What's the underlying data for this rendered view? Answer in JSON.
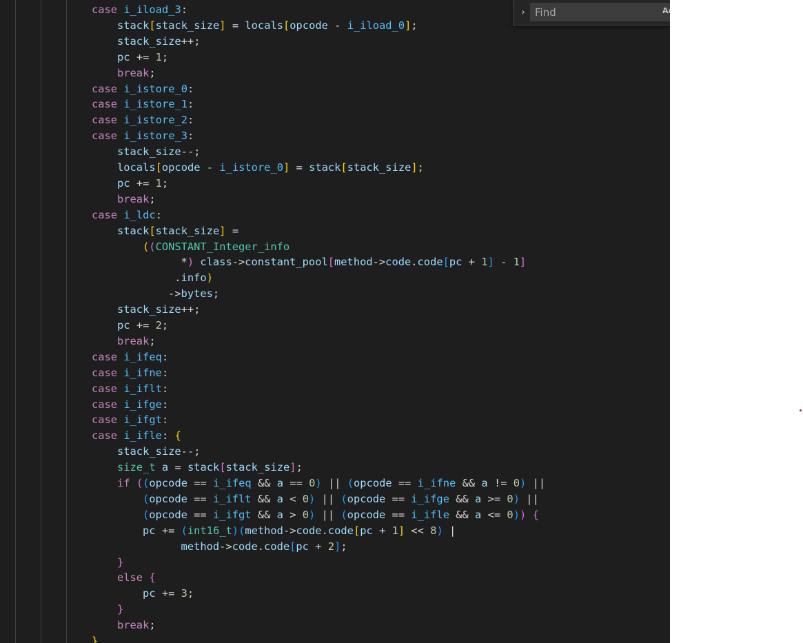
{
  "find_widget": {
    "toggle_icon": "chevron-right-icon",
    "placeholder": "Find",
    "value": "",
    "match_case_label": "Aa"
  },
  "code": {
    "lines": [
      {
        "indent": 2,
        "tokens": [
          [
            "case ",
            "k"
          ],
          [
            "i_iload_3",
            "c"
          ],
          [
            ":",
            "o"
          ]
        ]
      },
      {
        "indent": 3,
        "tokens": [
          [
            "stack",
            "i"
          ],
          [
            "[",
            "b1"
          ],
          [
            "stack_size",
            "i"
          ],
          [
            "]",
            "b1"
          ],
          [
            " = ",
            "o"
          ],
          [
            "locals",
            "i"
          ],
          [
            "[",
            "b1"
          ],
          [
            "opcode",
            "i"
          ],
          [
            " - ",
            "o"
          ],
          [
            "i_iload_0",
            "c"
          ],
          [
            "]",
            "b1"
          ],
          [
            ";",
            "o"
          ]
        ]
      },
      {
        "indent": 3,
        "tokens": [
          [
            "stack_size",
            "i"
          ],
          [
            "++;",
            "o"
          ]
        ]
      },
      {
        "indent": 3,
        "tokens": [
          [
            "pc",
            "i"
          ],
          [
            " += ",
            "o"
          ],
          [
            "1",
            "n"
          ],
          [
            ";",
            "o"
          ]
        ]
      },
      {
        "indent": 3,
        "tokens": [
          [
            "break",
            "k"
          ],
          [
            ";",
            "o"
          ]
        ]
      },
      {
        "indent": 2,
        "tokens": [
          [
            "case ",
            "k"
          ],
          [
            "i_istore_0",
            "c"
          ],
          [
            ":",
            "o"
          ]
        ]
      },
      {
        "indent": 2,
        "tokens": [
          [
            "case ",
            "k"
          ],
          [
            "i_istore_1",
            "c"
          ],
          [
            ":",
            "o"
          ]
        ]
      },
      {
        "indent": 2,
        "tokens": [
          [
            "case ",
            "k"
          ],
          [
            "i_istore_2",
            "c"
          ],
          [
            ":",
            "o"
          ]
        ]
      },
      {
        "indent": 2,
        "tokens": [
          [
            "case ",
            "k"
          ],
          [
            "i_istore_3",
            "c"
          ],
          [
            ":",
            "o"
          ]
        ]
      },
      {
        "indent": 3,
        "tokens": [
          [
            "stack_size",
            "i"
          ],
          [
            "--;",
            "o"
          ]
        ]
      },
      {
        "indent": 3,
        "tokens": [
          [
            "locals",
            "i"
          ],
          [
            "[",
            "b1"
          ],
          [
            "opcode",
            "i"
          ],
          [
            " - ",
            "o"
          ],
          [
            "i_istore_0",
            "c"
          ],
          [
            "]",
            "b1"
          ],
          [
            " = ",
            "o"
          ],
          [
            "stack",
            "i"
          ],
          [
            "[",
            "b1"
          ],
          [
            "stack_size",
            "i"
          ],
          [
            "]",
            "b1"
          ],
          [
            ";",
            "o"
          ]
        ]
      },
      {
        "indent": 3,
        "tokens": [
          [
            "pc",
            "i"
          ],
          [
            " += ",
            "o"
          ],
          [
            "1",
            "n"
          ],
          [
            ";",
            "o"
          ]
        ]
      },
      {
        "indent": 3,
        "tokens": [
          [
            "break",
            "k"
          ],
          [
            ";",
            "o"
          ]
        ]
      },
      {
        "indent": 2,
        "tokens": [
          [
            "case ",
            "k"
          ],
          [
            "i_ldc",
            "c"
          ],
          [
            ":",
            "o"
          ]
        ]
      },
      {
        "indent": 3,
        "tokens": [
          [
            "stack",
            "i"
          ],
          [
            "[",
            "b1"
          ],
          [
            "stack_size",
            "i"
          ],
          [
            "]",
            "b1"
          ],
          [
            " =",
            "o"
          ]
        ]
      },
      {
        "indent": 4,
        "tokens": [
          [
            "(",
            "b1"
          ],
          [
            "(",
            "b2"
          ],
          [
            "CONSTANT_Integer_info",
            "t"
          ]
        ]
      },
      {
        "indent": 5,
        "tokens": [
          [
            "  *",
            "o"
          ],
          [
            ")",
            "b2"
          ],
          [
            " ",
            "o"
          ],
          [
            "class",
            "i"
          ],
          [
            "->",
            "o"
          ],
          [
            "constant_pool",
            "i"
          ],
          [
            "[",
            "b2"
          ],
          [
            "method",
            "i"
          ],
          [
            "->",
            "o"
          ],
          [
            "code",
            "i"
          ],
          [
            ".",
            "o"
          ],
          [
            "code",
            "i"
          ],
          [
            "[",
            "b3"
          ],
          [
            "pc",
            "i"
          ],
          [
            " + ",
            "o"
          ],
          [
            "1",
            "n"
          ],
          [
            "]",
            "b3"
          ],
          [
            " - ",
            "o"
          ],
          [
            "1",
            "n"
          ],
          [
            "]",
            "b2"
          ]
        ]
      },
      {
        "indent": 5,
        "tokens": [
          [
            " .",
            "o"
          ],
          [
            "info",
            "i"
          ],
          [
            ")",
            "b1"
          ]
        ]
      },
      {
        "indent": 5,
        "tokens": [
          [
            "->",
            "o"
          ],
          [
            "bytes",
            "i"
          ],
          [
            ";",
            "o"
          ]
        ]
      },
      {
        "indent": 3,
        "tokens": [
          [
            "stack_size",
            "i"
          ],
          [
            "++;",
            "o"
          ]
        ]
      },
      {
        "indent": 3,
        "tokens": [
          [
            "pc",
            "i"
          ],
          [
            " += ",
            "o"
          ],
          [
            "2",
            "n"
          ],
          [
            ";",
            "o"
          ]
        ]
      },
      {
        "indent": 3,
        "tokens": [
          [
            "break",
            "k"
          ],
          [
            ";",
            "o"
          ]
        ]
      },
      {
        "indent": 2,
        "tokens": [
          [
            "case ",
            "k"
          ],
          [
            "i_ifeq",
            "c"
          ],
          [
            ":",
            "o"
          ]
        ]
      },
      {
        "indent": 2,
        "tokens": [
          [
            "case ",
            "k"
          ],
          [
            "i_ifne",
            "c"
          ],
          [
            ":",
            "o"
          ]
        ]
      },
      {
        "indent": 2,
        "tokens": [
          [
            "case ",
            "k"
          ],
          [
            "i_iflt",
            "c"
          ],
          [
            ":",
            "o"
          ]
        ]
      },
      {
        "indent": 2,
        "tokens": [
          [
            "case ",
            "k"
          ],
          [
            "i_ifge",
            "c"
          ],
          [
            ":",
            "o"
          ]
        ]
      },
      {
        "indent": 2,
        "tokens": [
          [
            "case ",
            "k"
          ],
          [
            "i_ifgt",
            "c"
          ],
          [
            ":",
            "o"
          ]
        ]
      },
      {
        "indent": 2,
        "tokens": [
          [
            "case ",
            "k"
          ],
          [
            "i_ifle",
            "c"
          ],
          [
            ": ",
            "o"
          ],
          [
            "{",
            "b1"
          ]
        ]
      },
      {
        "indent": 3,
        "tokens": [
          [
            "stack_size",
            "i"
          ],
          [
            "--;",
            "o"
          ]
        ]
      },
      {
        "indent": 3,
        "tokens": [
          [
            "size_t",
            "t"
          ],
          [
            " ",
            "o"
          ],
          [
            "a",
            "i"
          ],
          [
            " = ",
            "o"
          ],
          [
            "stack",
            "i"
          ],
          [
            "[",
            "b2"
          ],
          [
            "stack_size",
            "i"
          ],
          [
            "]",
            "b2"
          ],
          [
            ";",
            "o"
          ]
        ]
      },
      {
        "indent": 3,
        "tokens": [
          [
            "if ",
            "k"
          ],
          [
            "(",
            "b2"
          ],
          [
            "(",
            "b3"
          ],
          [
            "opcode",
            "i"
          ],
          [
            " == ",
            "o"
          ],
          [
            "i_ifeq",
            "c"
          ],
          [
            " && ",
            "o"
          ],
          [
            "a",
            "i"
          ],
          [
            " == ",
            "o"
          ],
          [
            "0",
            "n"
          ],
          [
            ")",
            "b3"
          ],
          [
            " || ",
            "o"
          ],
          [
            "(",
            "b3"
          ],
          [
            "opcode",
            "i"
          ],
          [
            " == ",
            "o"
          ],
          [
            "i_ifne",
            "c"
          ],
          [
            " && ",
            "o"
          ],
          [
            "a",
            "i"
          ],
          [
            " != ",
            "o"
          ],
          [
            "0",
            "n"
          ],
          [
            ")",
            "b3"
          ],
          [
            " ||",
            "o"
          ]
        ]
      },
      {
        "indent": 4,
        "tokens": [
          [
            "(",
            "b3"
          ],
          [
            "opcode",
            "i"
          ],
          [
            " == ",
            "o"
          ],
          [
            "i_iflt",
            "c"
          ],
          [
            " && ",
            "o"
          ],
          [
            "a",
            "i"
          ],
          [
            " < ",
            "o"
          ],
          [
            "0",
            "n"
          ],
          [
            ")",
            "b3"
          ],
          [
            " || ",
            "o"
          ],
          [
            "(",
            "b3"
          ],
          [
            "opcode",
            "i"
          ],
          [
            " == ",
            "o"
          ],
          [
            "i_ifge",
            "c"
          ],
          [
            " && ",
            "o"
          ],
          [
            "a",
            "i"
          ],
          [
            " >= ",
            "o"
          ],
          [
            "0",
            "n"
          ],
          [
            ")",
            "b3"
          ],
          [
            " ||",
            "o"
          ]
        ]
      },
      {
        "indent": 4,
        "tokens": [
          [
            "(",
            "b3"
          ],
          [
            "opcode",
            "i"
          ],
          [
            " == ",
            "o"
          ],
          [
            "i_ifgt",
            "c"
          ],
          [
            " && ",
            "o"
          ],
          [
            "a",
            "i"
          ],
          [
            " > ",
            "o"
          ],
          [
            "0",
            "n"
          ],
          [
            ")",
            "b3"
          ],
          [
            " || ",
            "o"
          ],
          [
            "(",
            "b3"
          ],
          [
            "opcode",
            "i"
          ],
          [
            " == ",
            "o"
          ],
          [
            "i_ifle",
            "c"
          ],
          [
            " && ",
            "o"
          ],
          [
            "a",
            "i"
          ],
          [
            " <= ",
            "o"
          ],
          [
            "0",
            "n"
          ],
          [
            ")",
            "b3"
          ],
          [
            ")",
            "b2"
          ],
          [
            " ",
            "o"
          ],
          [
            "{",
            "b2"
          ]
        ]
      },
      {
        "indent": 4,
        "tokens": [
          [
            "pc",
            "i"
          ],
          [
            " += ",
            "o"
          ],
          [
            "(",
            "b3"
          ],
          [
            "int16_t",
            "t"
          ],
          [
            ")",
            "b3"
          ],
          [
            "(",
            "b3"
          ],
          [
            "method",
            "i"
          ],
          [
            "->",
            "o"
          ],
          [
            "code",
            "i"
          ],
          [
            ".",
            "o"
          ],
          [
            "code",
            "i"
          ],
          [
            "[",
            "b1"
          ],
          [
            "pc",
            "i"
          ],
          [
            " + ",
            "o"
          ],
          [
            "1",
            "n"
          ],
          [
            "]",
            "b1"
          ],
          [
            " << ",
            "o"
          ],
          [
            "8",
            "n"
          ],
          [
            ")",
            "b3"
          ],
          [
            " |",
            "o"
          ]
        ]
      },
      {
        "indent": 5,
        "tokens": [
          [
            "  method",
            "i"
          ],
          [
            "->",
            "o"
          ],
          [
            "code",
            "i"
          ],
          [
            ".",
            "o"
          ],
          [
            "code",
            "i"
          ],
          [
            "[",
            "b3"
          ],
          [
            "pc",
            "i"
          ],
          [
            " + ",
            "o"
          ],
          [
            "2",
            "n"
          ],
          [
            "]",
            "b3"
          ],
          [
            ";",
            "o"
          ]
        ]
      },
      {
        "indent": 3,
        "tokens": [
          [
            "}",
            "b2"
          ]
        ]
      },
      {
        "indent": 3,
        "tokens": [
          [
            "else ",
            "k"
          ],
          [
            "{",
            "b2"
          ]
        ]
      },
      {
        "indent": 4,
        "tokens": [
          [
            "pc",
            "i"
          ],
          [
            " += ",
            "o"
          ],
          [
            "3",
            "n"
          ],
          [
            ";",
            "o"
          ]
        ]
      },
      {
        "indent": 3,
        "tokens": [
          [
            "}",
            "b2"
          ]
        ]
      },
      {
        "indent": 3,
        "tokens": [
          [
            "break",
            "k"
          ],
          [
            ";",
            "o"
          ]
        ]
      },
      {
        "indent": 2,
        "tokens": [
          [
            "}",
            "b1"
          ]
        ]
      }
    ]
  }
}
